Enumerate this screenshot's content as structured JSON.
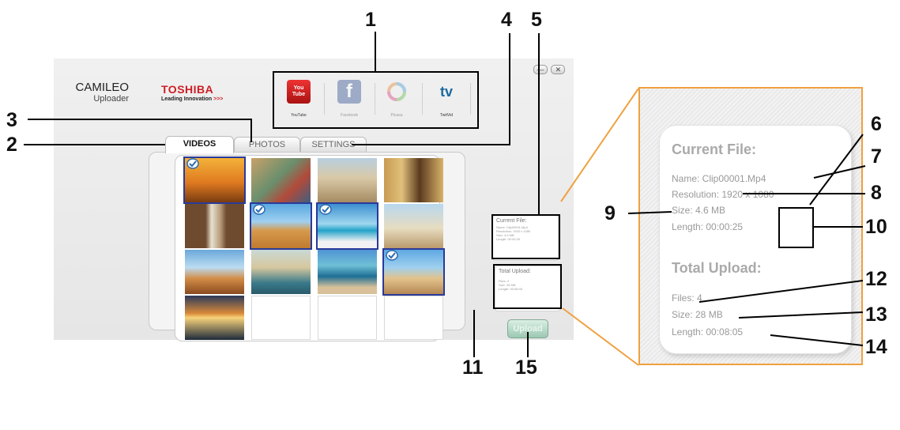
{
  "app": {
    "brand_title": "CAMILEO",
    "brand_subtitle": "Uploader",
    "toshiba_name": "TOSHIBA",
    "toshiba_tagline": "Leading Innovation",
    "toshiba_arrows": ">>>",
    "window_buttons": {
      "minimize": "—",
      "close": "✕"
    }
  },
  "services": [
    {
      "label": "YouTube",
      "icon": "youtube-icon",
      "icon_text": "You Tube",
      "color": "#cc2222"
    },
    {
      "label": "Facebook",
      "icon": "facebook-icon",
      "icon_text": "f",
      "color": "#3b5998"
    },
    {
      "label": "Picasa",
      "icon": "picasa-icon",
      "icon_text": "",
      "color": "#e88a3a"
    },
    {
      "label": "TwitVid",
      "icon": "twitvid-icon",
      "icon_text": "tv",
      "color": "#1a6aa0"
    }
  ],
  "tabs": [
    {
      "label": "VIDEOS",
      "active": true
    },
    {
      "label": "PHOTOS",
      "active": false
    },
    {
      "label": "SETTINGS",
      "active": false
    }
  ],
  "thumbnails": [
    {
      "scene": "camel-sunset",
      "selected": true
    },
    {
      "scene": "market",
      "selected": false
    },
    {
      "scene": "ruins",
      "selected": false
    },
    {
      "scene": "egyptian-art",
      "selected": false
    },
    {
      "scene": "doorway",
      "selected": false
    },
    {
      "scene": "pyramids",
      "selected": true
    },
    {
      "scene": "sea",
      "selected": true
    },
    {
      "scene": "sphinx",
      "selected": false
    },
    {
      "scene": "camels",
      "selected": false
    },
    {
      "scene": "river-town",
      "selected": false
    },
    {
      "scene": "coast",
      "selected": false
    },
    {
      "scene": "camel-rider",
      "selected": true
    },
    {
      "scene": "lake-sunset",
      "selected": false
    },
    {
      "scene": "empty",
      "selected": false
    },
    {
      "scene": "empty",
      "selected": false
    },
    {
      "scene": "empty",
      "selected": false
    }
  ],
  "current_file": {
    "heading": "Current File:",
    "name": "Name: Clip00001.Mp4",
    "resolution": "Resolution: 1920 x 1080",
    "size": "Size: 4.6 MB",
    "length": "Length: 00:00:25"
  },
  "total_upload": {
    "heading": "Total Upload:",
    "files": "Files: 4",
    "size": "Size: 28 MB",
    "length": "Length: 00:08:05"
  },
  "upload_button": "Upload",
  "callouts": [
    "1",
    "2",
    "3",
    "4",
    "5",
    "6",
    "7",
    "8",
    "9",
    "10",
    "11",
    "12",
    "13",
    "14",
    "15"
  ],
  "colors": {
    "accent_orange": "#f0a040",
    "selected_border": "#2a3a9a",
    "toshiba_red": "#cc1e26"
  }
}
